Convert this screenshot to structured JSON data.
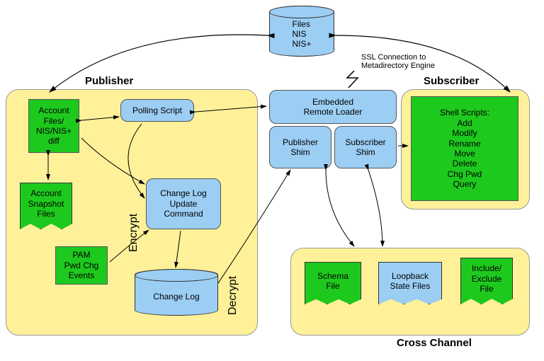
{
  "title_publisher": "Publisher",
  "title_subscriber": "Subscriber",
  "title_cross": "Cross Channel",
  "top_db": "Files\nNIS\nNIS+",
  "ssl_note": "SSL Connection to\nMetadirectory Engine",
  "acct_files": "Account\nFiles/\nNIS/NIS+\ndiff",
  "polling": "Polling Script",
  "snapshot": "Account\nSnapshot\nFiles",
  "change_update": "Change Log\nUpdate\nCommand",
  "pam": "PAM\nPwd Chg\nEvents",
  "change_log_db": "Change Log",
  "encrypt": "Encrypt",
  "decrypt": "Decrypt",
  "embedded": "Embedded\nRemote Loader",
  "pub_shim": "Publisher\nShim",
  "sub_shim": "Subscriber\nShim",
  "shell_scripts": "Shell Scripts:\nAdd\nModify\nRename\nMove\nDelete\nChg Pwd\nQuery",
  "schema": "Schema\nFile",
  "loopback": "Loopback\nState Files",
  "include": "Include/\nExclude\nFile"
}
